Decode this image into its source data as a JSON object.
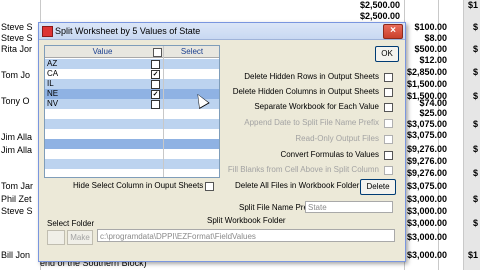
{
  "spreadsheet": {
    "left_names": [
      "Steve S",
      "Steve S",
      "Rita Jor",
      "Tom Jo",
      "Tony O",
      "Jim Alla",
      "Jim Alla",
      "Tom Jar",
      "Phil Zet",
      "Steve S",
      "Bill Jon"
    ],
    "bottom_text": "end of the Southern Block)",
    "top_values": [
      "$2,500.00",
      "$2,500.00"
    ],
    "right_values": [
      "$100.00",
      "$8.00",
      "$500.00",
      "$12.00",
      "$2,850.00",
      "$1,500.00",
      "$1,500.00",
      "$74.00",
      "$25.00",
      "$3,075.00",
      "$3,075.00",
      "$9,276.00",
      "$9,276.00",
      "$9,276.00",
      "$3,075.00",
      "$3,000.00",
      "$3,000.00",
      "$3,000.00",
      "$3,000.00",
      "$3,000.00"
    ],
    "right_edge_values": [
      "$1",
      "$",
      "$",
      "$",
      "$",
      "$",
      "$",
      "$",
      "$",
      "$",
      "$",
      "$",
      "$",
      "$",
      "$",
      "$",
      "$",
      "$",
      "$",
      "$",
      "$",
      "$",
      "$1"
    ]
  },
  "dialog": {
    "title": "Split Worksheet by 5 Values of State",
    "close_glyph": "×",
    "ok_label": "OK",
    "grid": {
      "value_header": "Value",
      "select_header": "Select",
      "rows": [
        {
          "value": "AZ",
          "checked": false
        },
        {
          "value": "CA",
          "checked": true
        },
        {
          "value": "IL",
          "checked": false
        },
        {
          "value": "NE",
          "checked": true
        },
        {
          "value": "NV",
          "checked": false
        }
      ]
    },
    "options": {
      "delete_hidden_rows": "Delete Hidden Rows in Output Sheets",
      "delete_hidden_columns": "Delete Hidden Columns in Output Sheets",
      "separate_workbook": "Separate Workbook for Each Value",
      "append_date": "Append Date to Split File Name Prefix",
      "readonly_output": "Read-Only Output Files",
      "convert_formulas": "Convert Formulas to Values",
      "fill_blanks": "Fill Blanks from Cell Above in Split Column"
    },
    "hide_select_column": "Hide Select Column in Ouput Sheets",
    "delete_all_files": "Delete All Files in Workbook Folder",
    "delete_button": "Delete",
    "split_prefix_label": "Split File Name Prefix",
    "split_prefix_value": "State",
    "select_folder_label": "Select Folder",
    "make_button": "Make",
    "workbook_folder_label": "Split Workbook Folder",
    "workbook_folder_path": "c:\\programdata\\DPPI\\EZFormat\\FieldValues",
    "colors": {
      "accent": "#7a96df",
      "stripe": "#bcd3ef",
      "selected": "#8fb2e3",
      "dialog_bg": "#ece9d8"
    }
  }
}
